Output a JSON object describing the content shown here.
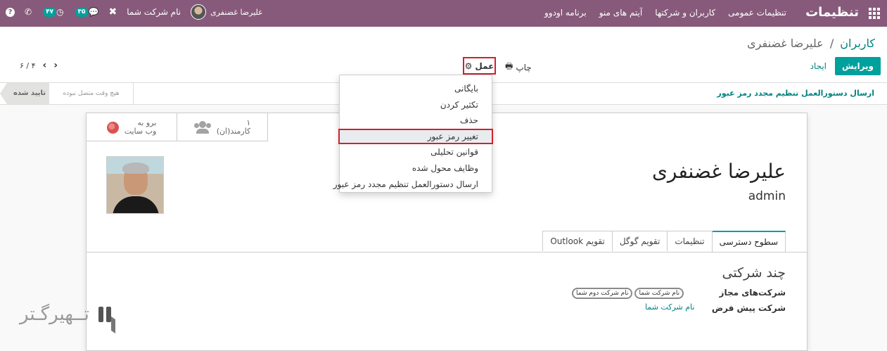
{
  "navbar": {
    "app_title": "تنظیمات",
    "menu": [
      "تنظیمات عمومی",
      "کاربران و شرکتها",
      "آیتم های منو",
      "برنامه اودوو"
    ],
    "user_name": "علیرضا غضنفری",
    "company_name": "نام شرکت شما",
    "messages_count": "۳۵",
    "activities_count": "۴۷",
    "help_glyph": "?"
  },
  "breadcrumb": {
    "parent": "کاربران",
    "separator": "/",
    "current": "علیرضا غضنفری"
  },
  "control_panel": {
    "edit_label": "ویرایش",
    "create_label": "ایجاد",
    "print_label": "چاپ",
    "action_label": "عمل",
    "pager_value": "۶ / ۴"
  },
  "action_menu": {
    "items": [
      "بایگانی",
      "تکثیر کردن",
      "حذف",
      "تغییر رمز عبور",
      "قوانین تحلیلی",
      "وظایف محول شده",
      "ارسال دستورالعمل تنظیم مجدد رمز عبور"
    ],
    "selected_index": 3
  },
  "statusbar": {
    "header_button": "ارسال دستورالعمل تنظیم مجدد رمز عبور",
    "stage_active": "تایید شده",
    "stage_other": "هیچ وقت متصل نبوده"
  },
  "smart_buttons": {
    "employees_count": "۱",
    "employees_label": "کارمند(ان)",
    "website_line1": "برو به",
    "website_line2": "وب سایت"
  },
  "form": {
    "name": "علیرضا غضنفری",
    "login": "admin",
    "tabs": [
      "سطوح دسترسی",
      "تنظیمات",
      "تقویم گوگل",
      "تقویم Outlook"
    ],
    "active_tab_index": 0,
    "group_title": "چند شرکتی",
    "allowed_companies_label": "شرکت‌های مجاز",
    "allowed_companies": [
      "نام شرکت دوم شما",
      "نام شرکت شما"
    ],
    "default_company_label": "شرکت پیش فرض",
    "default_company": "نام شرکت شما"
  },
  "watermark": {
    "text": "تــهیرگـتر"
  },
  "colors": {
    "brand": "#875a7b",
    "primary": "#00a09d",
    "link": "#00827f",
    "highlight": "#d2202f"
  }
}
